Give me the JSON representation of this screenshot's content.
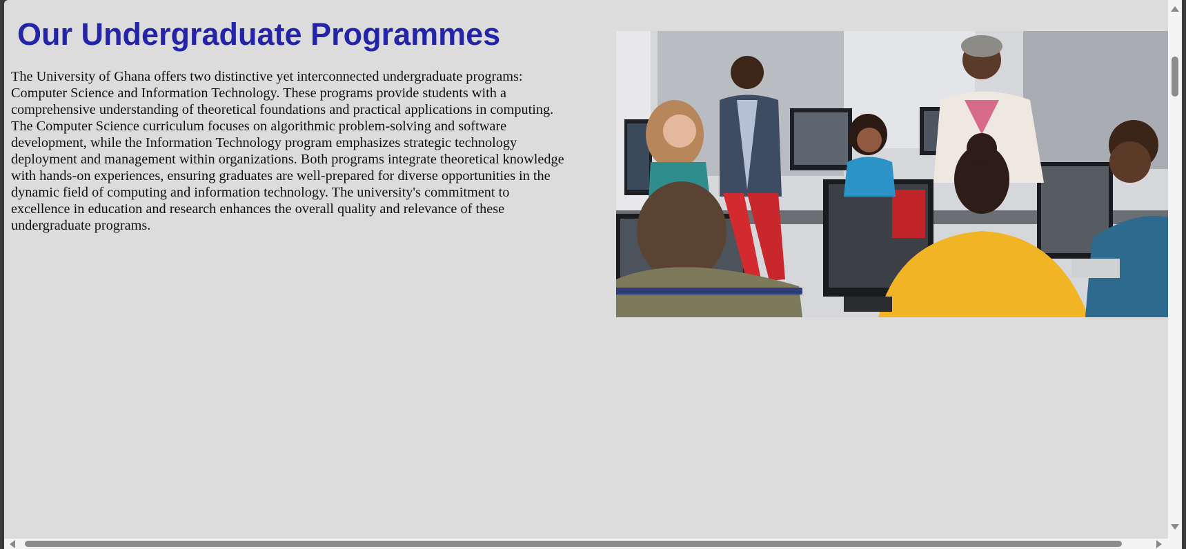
{
  "page": {
    "title": "Our Undergraduate Programmes",
    "intro": "The University of Ghana offers two distinctive yet interconnected undergraduate programs: Computer Science and Information Technology. These programs provide students with a comprehensive understanding of theoretical foundations and practical applications in computing. The Computer Science curriculum focuses on algorithmic problem-solving and software development, while the Information Technology program emphasizes strategic technology deployment and management within organizations. Both programs integrate theoretical knowledge with hands-on experiences, ensuring graduates are well-prepared for diverse opportunities in the dynamic field of computing and information technology. The university's commitment to excellence in education and research enhances the overall quality and relevance of these undergraduate programs."
  },
  "colors": {
    "title": "#2424a8",
    "page_background": "#dcdcdc",
    "body_text": "#111111"
  },
  "icons": {
    "scroll_up": "triangle-up-icon",
    "scroll_down": "triangle-down-icon",
    "scroll_left": "triangle-left-icon",
    "scroll_right": "triangle-right-icon"
  }
}
